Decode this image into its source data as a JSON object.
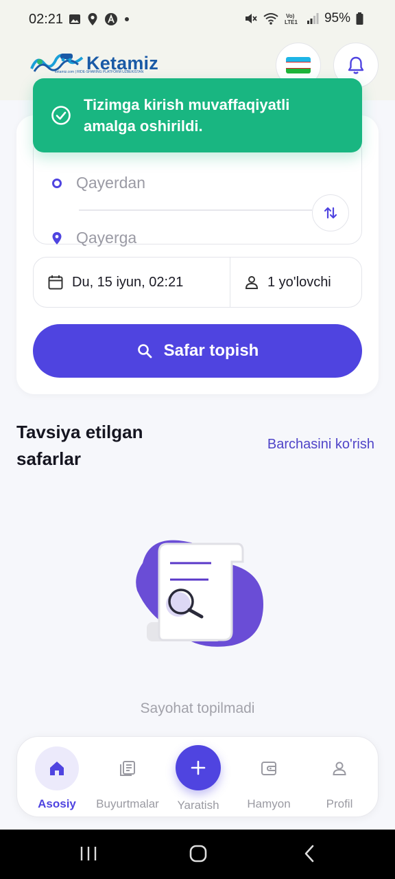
{
  "status_bar": {
    "time": "02:21",
    "battery": "95%",
    "left_icons": [
      "image-icon",
      "location-icon",
      "app-icon",
      "dot-icon"
    ],
    "right_icons": [
      "mute-icon",
      "wifi-icon",
      "volte-icon",
      "signal-icon",
      "battery-icon"
    ]
  },
  "header": {
    "brand": "Ketamiz",
    "tagline": "ketamiz.com | RIDE-SHARING PLATFORM UZBEKISTAN",
    "flag_colors": [
      "#1eb5e6",
      "#ffffff",
      "#1eb53a"
    ]
  },
  "toast": {
    "message": "Tizimga kirish muvaffaqiyatli amalga oshirildi."
  },
  "search": {
    "from_placeholder": "Qayerdan",
    "to_placeholder": "Qayerga",
    "date": "Du, 15 iyun, 02:21",
    "passengers": "1 yo'lovchi",
    "button_label": "Safar topish"
  },
  "recommended": {
    "title": "Tavsiya etilgan safarlar",
    "see_all": "Barchasini ko'rish",
    "empty_text": "Sayohat topilmadi"
  },
  "bottom_nav": {
    "items": [
      {
        "label": "Asosiy",
        "icon": "home-icon",
        "active": true
      },
      {
        "label": "Buyurtmalar",
        "icon": "orders-icon",
        "active": false
      },
      {
        "label": "Yaratish",
        "icon": "plus-icon",
        "active": false
      },
      {
        "label": "Hamyon",
        "icon": "wallet-icon",
        "active": false
      },
      {
        "label": "Profil",
        "icon": "profile-icon",
        "active": false
      }
    ]
  },
  "colors": {
    "primary": "#4f44e0",
    "success": "#19b681",
    "background": "#f6f7fb"
  }
}
